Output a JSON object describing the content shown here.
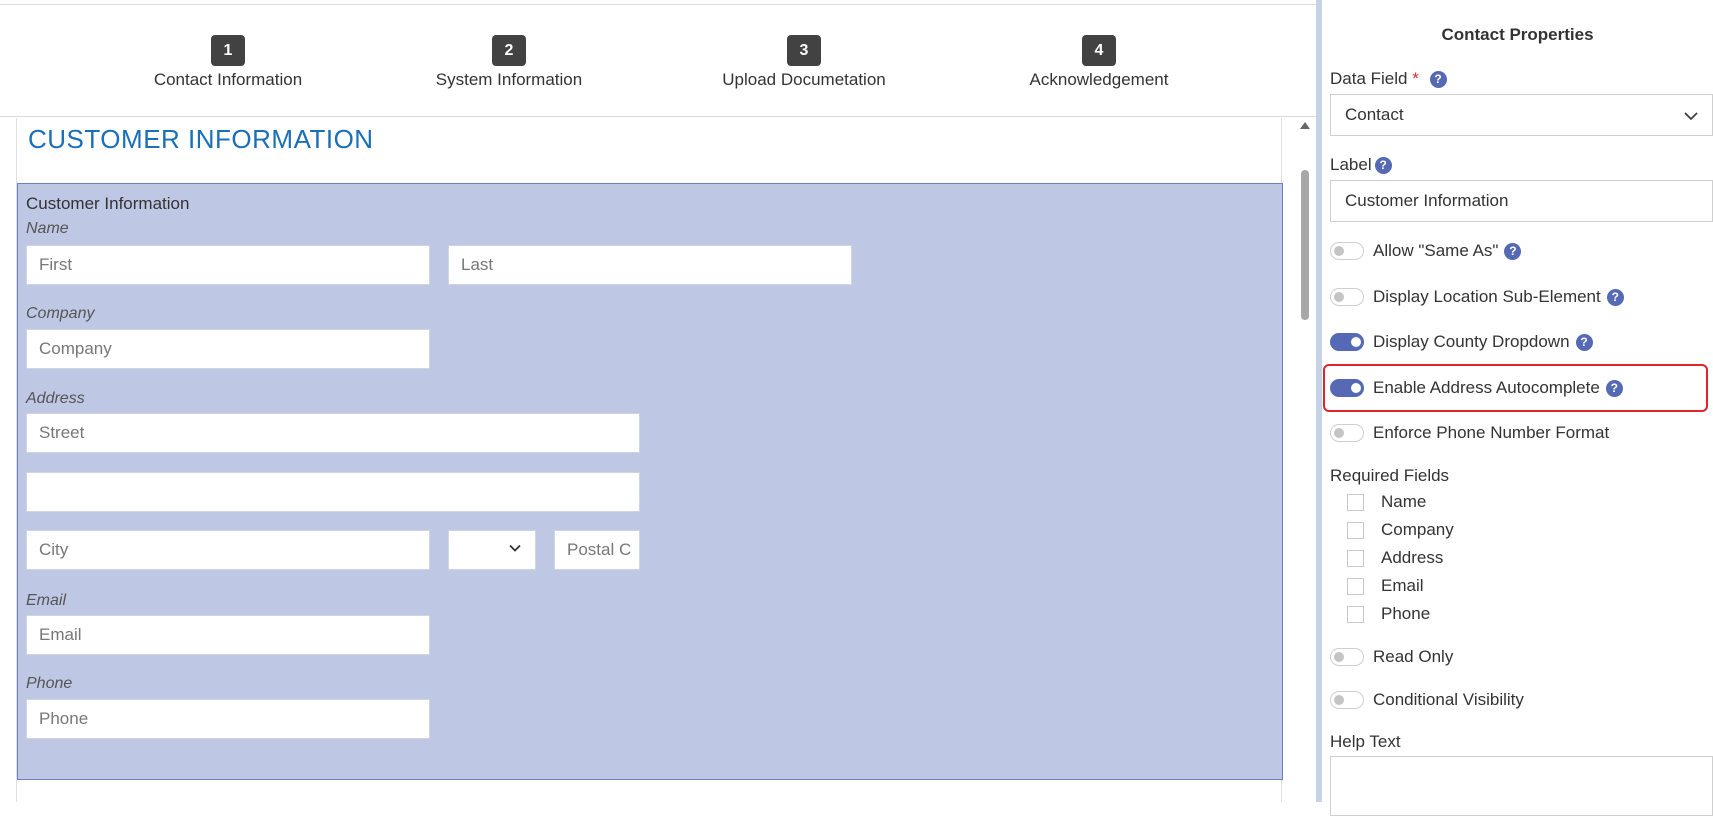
{
  "steps": [
    {
      "num": "1",
      "label": "Contact Information"
    },
    {
      "num": "2",
      "label": "System Information"
    },
    {
      "num": "3",
      "label": "Upload Documetation"
    },
    {
      "num": "4",
      "label": "Acknowledgement"
    }
  ],
  "form": {
    "section_title": "CUSTOMER INFORMATION",
    "block_title": "Customer Information",
    "name_label": "Name",
    "first_placeholder": "First",
    "last_placeholder": "Last",
    "company_label": "Company",
    "company_placeholder": "Company",
    "address_label": "Address",
    "street_placeholder": "Street",
    "street2_placeholder": "",
    "city_placeholder": "City",
    "postal_placeholder": "Postal C",
    "email_label": "Email",
    "email_placeholder": "Email",
    "phone_label": "Phone",
    "phone_placeholder": "Phone"
  },
  "properties": {
    "title": "Contact Properties",
    "data_field_label": "Data Field",
    "required_marker": "*",
    "help_glyph": "?",
    "data_field_value": "Contact",
    "label_label": "Label",
    "label_value": "Customer Information",
    "toggles": [
      {
        "label": "Allow \"Same As\"",
        "on": false,
        "help": true
      },
      {
        "label": "Display Location Sub-Element",
        "on": false,
        "help": true
      },
      {
        "label": "Display County Dropdown",
        "on": true,
        "help": true
      },
      {
        "label": "Enable Address Autocomplete",
        "on": true,
        "help": true
      },
      {
        "label": "Enforce Phone Number Format",
        "on": false,
        "help": false
      }
    ],
    "required_fields_label": "Required Fields",
    "required_fields": [
      "Name",
      "Company",
      "Address",
      "Email",
      "Phone"
    ],
    "read_only_label": "Read Only",
    "read_only_on": false,
    "conditional_visibility_label": "Conditional Visibility",
    "conditional_visibility_on": false,
    "help_text_label": "Help Text",
    "accent_color": "#5569b4",
    "highlight_color": "#e0242b"
  }
}
